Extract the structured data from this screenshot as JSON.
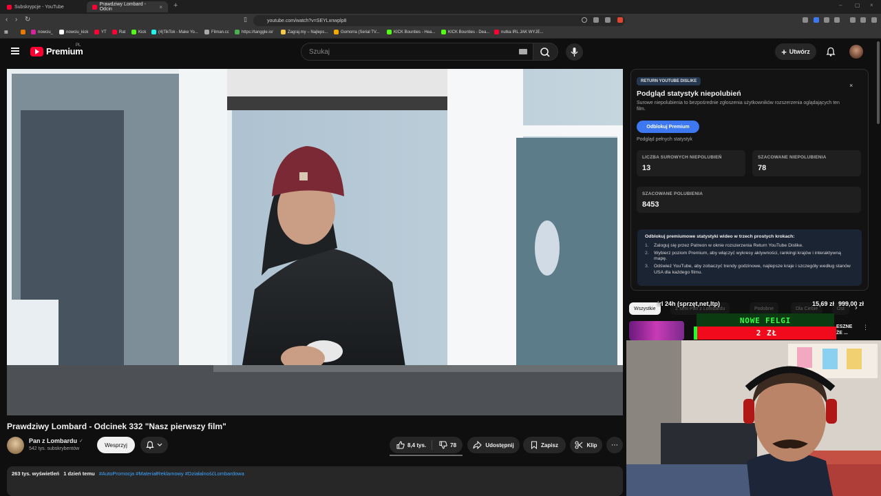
{
  "browser": {
    "tabs": [
      {
        "label": "Subskrypcje - YouTube"
      },
      {
        "label": "Prawdziwy Lombard - Odcin"
      }
    ],
    "new_tab": "+",
    "url": "youtube.com/watch?v=SEYLxnwplp8",
    "bookmarks": [
      {
        "label": "nowciu_",
        "color": "#d6249f"
      },
      {
        "label": "nowciu_kick",
        "color": "#ffffff"
      },
      {
        "label": "YT",
        "color": "#ff0033"
      },
      {
        "label": "Rat",
        "color": "#ff0033"
      },
      {
        "label": "Kick",
        "color": "#53fc18"
      },
      {
        "label": "(4)TikTok - Make Yo...",
        "color": "#25f4ee"
      },
      {
        "label": "Filman.cc",
        "color": "#aaaaaa"
      },
      {
        "label": "https://tanggle.io/",
        "color": "#4caf50"
      },
      {
        "label": "Zagraj.my – Najleps...",
        "color": "#f2c94c"
      },
      {
        "label": "Gomorra (Serial TV...",
        "color": "#f2a900"
      },
      {
        "label": "KICK Bounties - Hea...",
        "color": "#53fc18"
      },
      {
        "label": "KICK Bounties - Dea...",
        "color": "#53fc18"
      },
      {
        "label": "nutka IRL JAK WYJE...",
        "color": "#ff0033"
      }
    ]
  },
  "header": {
    "logo_word": "Premium",
    "region": "PL",
    "search_placeholder": "Szukaj",
    "create_label": "Utwórz"
  },
  "video": {
    "title": "Prawdziwy Lombard - Odcinek 332 \"Nasz pierwszy film\"",
    "channel_name": "Pan z Lombardu",
    "verified_mark": "✓",
    "subscribers": "542 tys. subskrybentów",
    "support_label": "Wesprzyj",
    "likes": "8,4 tys.",
    "dislikes": "78",
    "share_label": "Udostępnij",
    "save_label": "Zapisz",
    "clip_label": "Klip",
    "more": "⋯",
    "views": "263 tys. wyświetleń",
    "date": "1 dzień temu",
    "tags": "#AutoPromocja #MateriałReklamowy #DziałalnośćLombardowa"
  },
  "ryd": {
    "badge": "RETURN YOUTUBE DISLIKE",
    "close": "×",
    "title": "Podgląd statystyk niepolubień",
    "description": "Surowe niepolubienia to bezpośrednie zgłoszenia użytkowników rozszerzenia oglądających ten film.",
    "unlock_label": "Odblokuj Premium",
    "preview_label": "Podgląd pełnych statystyk",
    "stats": [
      {
        "label": "LICZBA SUROWYCH NIEPOLUBIEŃ",
        "value": "13"
      },
      {
        "label": "SZACOWANE NIEPOLUBIENIA",
        "value": "78"
      },
      {
        "label": "SZACOWANE POLUBIENIA",
        "value": "8453"
      }
    ],
    "steps_head": "Odblokuj premiumowe statystyki wideo w trzech prostych krokach:",
    "steps": [
      {
        "num": "1.",
        "text": "Zaloguj się przez Patreon w oknie rozszerzenia Return YouTube Dislike."
      },
      {
        "num": "2.",
        "text": "Wybierz poziom Premium, aby włączyć wykresy aktywności, rankingi krajów i interaktywną mapę."
      },
      {
        "num": "3.",
        "text": "Odśwież YouTube, aby zobaczyć trendy godzinowe, najlepsze kraje i szczegóły według stanów USA dla każdego filmu."
      }
    ]
  },
  "chips": [
    {
      "label": "Wszystkie"
    },
    {
      "label": "Z serii Pan z Lombardu"
    },
    {
      "label": "Podobne"
    },
    {
      "label": "Dla Ciebie"
    },
    {
      "label": "Ost"
    }
  ],
  "overlay": {
    "goal_text": "irl 24h (sprzęt,net,ltp)",
    "goal_current": "15,69 zł",
    "goal_target": "999,00 zł",
    "green_text": "NOWE FELGI",
    "red_text": "2 ZŁ"
  },
  "sidebar_snippet": "ESZNE\nŻE ...",
  "colors": {
    "yt_red": "#ff0033",
    "ryd_blue": "#3d78f0",
    "tag_blue": "#3ea6ff",
    "overlay_green": "#35ff45",
    "overlay_red": "#f00a1c"
  }
}
